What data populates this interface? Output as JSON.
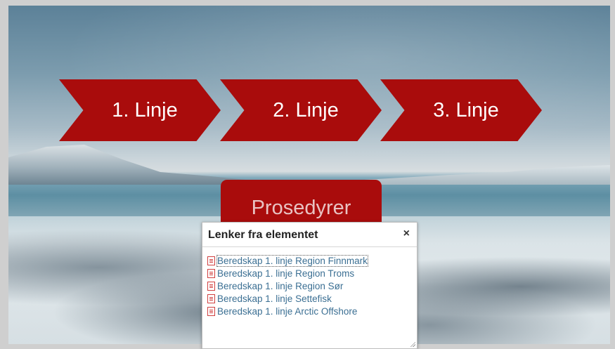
{
  "chevrons": [
    {
      "label": "1. Linje"
    },
    {
      "label": "2. Linje"
    },
    {
      "label": "3. Linje"
    }
  ],
  "procedures_button": {
    "label": "Prosedyrer"
  },
  "popup": {
    "title": "Lenker fra elementet",
    "close_glyph": "×",
    "links": [
      {
        "label": "Beredskap 1. linje Region Finnmark",
        "icon": "pdf-icon"
      },
      {
        "label": "Beredskap 1. linje Region Troms",
        "icon": "pdf-icon"
      },
      {
        "label": "Beredskap 1. linje Region Sør",
        "icon": "pdf-icon"
      },
      {
        "label": "Beredskap 1. linje Settefisk",
        "icon": "pdf-icon"
      },
      {
        "label": "Beredskap 1. linje Arctic Offshore",
        "icon": "pdf-icon"
      }
    ]
  },
  "colors": {
    "accent": "#a90c0c",
    "link": "#3b6f93"
  }
}
